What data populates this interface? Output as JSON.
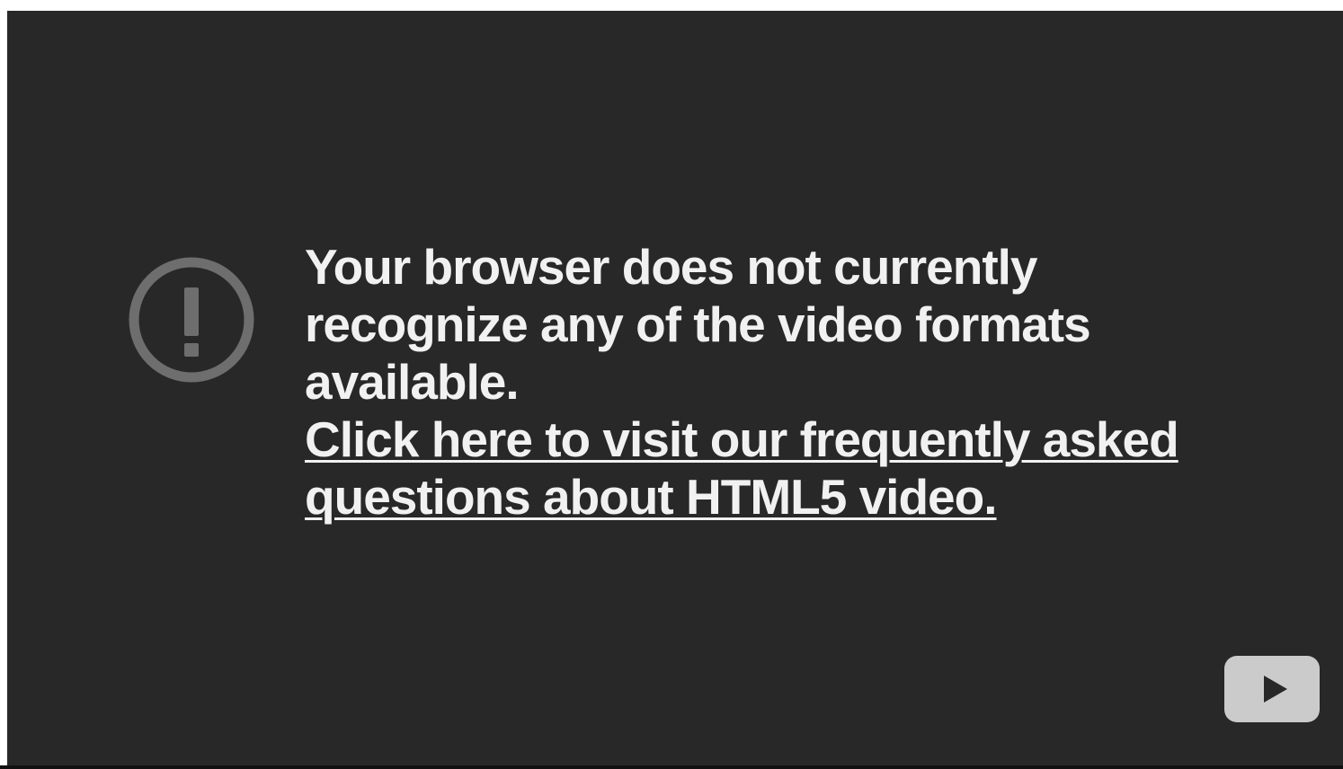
{
  "error": {
    "message": "Your browser does not currently recognize any of the video formats available.",
    "faq_link": "Click here to visit our frequently asked questions about HTML5 video.",
    "icon": "exclamation-circle-icon"
  },
  "player": {
    "logo_icon": "youtube-play-icon",
    "colors": {
      "background": "#282828",
      "text": "#f1f1f1",
      "icon": "#6e6e6e",
      "logo": "#cbcbcb"
    }
  }
}
